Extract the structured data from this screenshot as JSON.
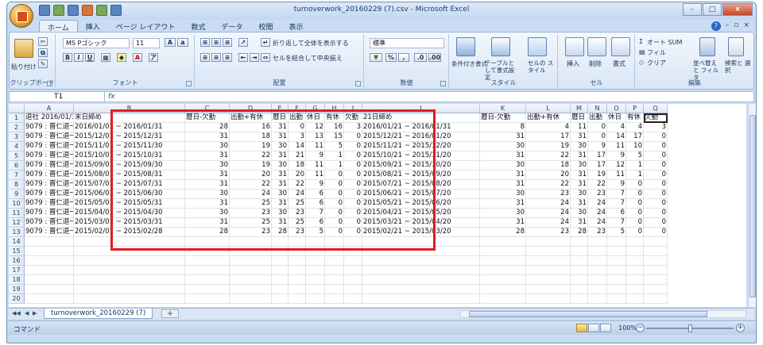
{
  "window": {
    "title": "turnoverwork_20160229 (7).csv - Microsoft Excel"
  },
  "ribbon": {
    "tabs": [
      "ホーム",
      "挿入",
      "ページ レイアウト",
      "数式",
      "データ",
      "校閲",
      "表示"
    ],
    "clipboard": {
      "paste": "貼り付け",
      "label": "クリップボード"
    },
    "font": {
      "name": "MS Pゴシック",
      "size": "11",
      "label": "フォント"
    },
    "alignment": {
      "wrap": "折り返して全体を表示する",
      "merge": "セルを結合して中央揃え",
      "label": "配置"
    },
    "number": {
      "format": "標準",
      "label": "数値"
    },
    "styles": {
      "conditional": "条件付き書式",
      "table": "テーブルとして書式設定",
      "cell": "セルの スタイル",
      "label": "スタイル"
    },
    "cells": {
      "insert": "挿入",
      "delete": "削除",
      "format": "書式",
      "label": "セル"
    },
    "editing": {
      "autosum": "オート SUM",
      "fill": "フィル",
      "clear": "クリア",
      "sort": "並べ替えと フィルタ",
      "find": "検索と 選択",
      "label": "編集"
    }
  },
  "formula_bar": {
    "name_box": "T1",
    "fx": "fx",
    "content": ""
  },
  "sheet": {
    "columns": [
      "A",
      "B",
      "C",
      "D",
      "E",
      "F",
      "G",
      "H",
      "I",
      "J",
      "K",
      "L",
      "M",
      "N",
      "O",
      "P",
      "Q"
    ],
    "header_row": [
      "退社 2016/01/31",
      "末日締め",
      "暦日-欠勤",
      "出勤+有休",
      "暦日",
      "出勤",
      "休日",
      "有休",
      "欠勤",
      "21日締め",
      "暦日-欠勤",
      "出勤+有休",
      "暦日",
      "出勤",
      "休日",
      "有休",
      "欠勤"
    ],
    "rows": [
      [
        "9079 : 晋仁退一郎",
        "2016/01/01 ~ 2016/01/31",
        "28",
        "16",
        "31",
        "0",
        "12",
        "16",
        "3",
        "2016/01/21 ~ 2016/01/31",
        "8",
        "4",
        "11",
        "0",
        "4",
        "4",
        "3"
      ],
      [
        "9079 : 晋仁退一郎",
        "2015/12/01 ~ 2015/12/31",
        "31",
        "18",
        "31",
        "3",
        "13",
        "15",
        "0",
        "2015/12/21 ~ 2016/01/20",
        "31",
        "17",
        "31",
        "0",
        "14",
        "17",
        "0"
      ],
      [
        "9079 : 晋仁退一郎",
        "2015/11/01 ~ 2015/11/30",
        "30",
        "19",
        "30",
        "14",
        "11",
        "5",
        "0",
        "2015/11/21 ~ 2015/12/20",
        "30",
        "19",
        "30",
        "9",
        "11",
        "10",
        "0"
      ],
      [
        "9079 : 晋仁退一郎",
        "2015/10/01 ~ 2015/10/31",
        "31",
        "22",
        "31",
        "21",
        "9",
        "1",
        "0",
        "2015/10/21 ~ 2015/11/20",
        "31",
        "22",
        "31",
        "17",
        "9",
        "5",
        "0"
      ],
      [
        "9079 : 晋仁退一郎",
        "2015/09/01 ~ 2015/09/30",
        "30",
        "19",
        "30",
        "18",
        "11",
        "1",
        "0",
        "2015/09/21 ~ 2015/10/20",
        "30",
        "18",
        "30",
        "17",
        "12",
        "1",
        "0"
      ],
      [
        "9079 : 晋仁退一郎",
        "2015/08/01 ~ 2015/08/31",
        "31",
        "20",
        "31",
        "20",
        "11",
        "0",
        "0",
        "2015/08/21 ~ 2015/09/20",
        "31",
        "20",
        "31",
        "19",
        "11",
        "1",
        "0"
      ],
      [
        "9079 : 晋仁退一郎",
        "2015/07/01 ~ 2015/07/31",
        "31",
        "22",
        "31",
        "22",
        "9",
        "0",
        "0",
        "2015/07/21 ~ 2015/08/20",
        "31",
        "22",
        "31",
        "22",
        "9",
        "0",
        "0"
      ],
      [
        "9079 : 晋仁退一郎",
        "2015/06/01 ~ 2015/06/30",
        "30",
        "24",
        "30",
        "24",
        "6",
        "0",
        "0",
        "2015/06/21 ~ 2015/07/20",
        "30",
        "23",
        "30",
        "23",
        "7",
        "0",
        "0"
      ],
      [
        "9079 : 晋仁退一郎",
        "2015/05/01 ~ 2015/05/31",
        "31",
        "25",
        "31",
        "25",
        "6",
        "0",
        "0",
        "2015/05/21 ~ 2015/06/20",
        "31",
        "24",
        "31",
        "24",
        "7",
        "0",
        "0"
      ],
      [
        "9079 : 晋仁退一郎",
        "2015/04/01 ~ 2015/04/30",
        "30",
        "23",
        "30",
        "23",
        "7",
        "0",
        "0",
        "2015/04/21 ~ 2015/05/20",
        "30",
        "24",
        "30",
        "24",
        "6",
        "0",
        "0"
      ],
      [
        "9079 : 晋仁退一郎",
        "2015/03/01 ~ 2015/03/31",
        "31",
        "25",
        "31",
        "25",
        "6",
        "0",
        "0",
        "2015/03/21 ~ 2015/04/20",
        "31",
        "24",
        "31",
        "24",
        "7",
        "0",
        "0"
      ],
      [
        "9079 : 晋仁退一郎",
        "2015/02/01 ~ 2015/02/28",
        "28",
        "23",
        "28",
        "23",
        "5",
        "0",
        "0",
        "2015/02/21 ~ 2015/03/20",
        "28",
        "23",
        "28",
        "23",
        "5",
        "0",
        "0"
      ]
    ],
    "blank_rows": 7
  },
  "sheet_tab": {
    "name": "turnoverwork_20160229 (7)"
  },
  "status": {
    "mode": "コマンド",
    "zoom": "100%"
  }
}
